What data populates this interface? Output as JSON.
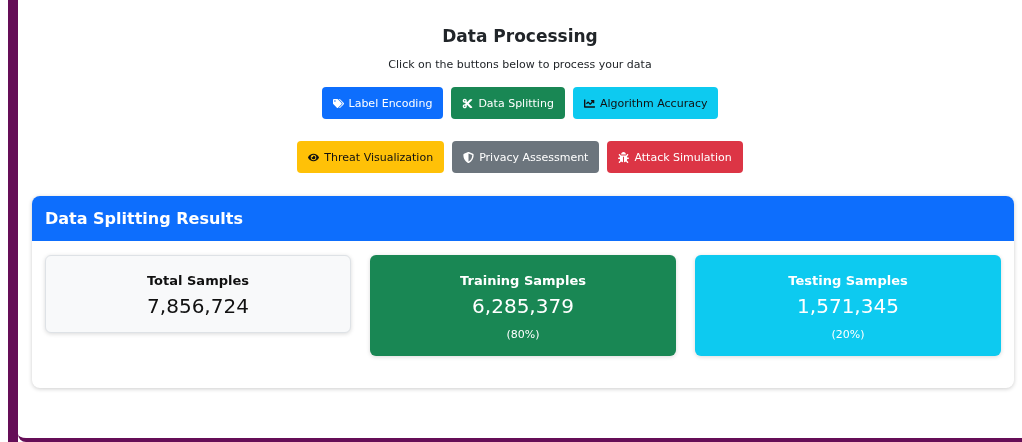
{
  "header": {
    "title": "Data Processing",
    "subtitle": "Click on the buttons below to process your data"
  },
  "button_rows": [
    [
      {
        "label": "Label Encoding",
        "color": "#0d6efd"
      },
      {
        "label": "Data Splitting",
        "color": "#198754"
      },
      {
        "label": "Algorithm Accuracy",
        "color": "#0dcaf0"
      }
    ],
    [
      {
        "label": "Threat Visualization",
        "color": "#ffc107"
      },
      {
        "label": "Privacy Assessment",
        "color": "#6c757d"
      },
      {
        "label": "Attack Simulation",
        "color": "#dc3545"
      }
    ]
  ],
  "results": {
    "title": "Data Splitting Results",
    "stats": [
      {
        "label": "Total Samples",
        "value": "7,856,724",
        "color": "#f8f9fa"
      },
      {
        "label": "Training Samples",
        "value": "6,285,379",
        "share": "(80%)",
        "color": "#198754"
      },
      {
        "label": "Testing Samples",
        "value": "1,571,345",
        "share": "(20%)",
        "color": "#0dcaf0"
      }
    ]
  }
}
